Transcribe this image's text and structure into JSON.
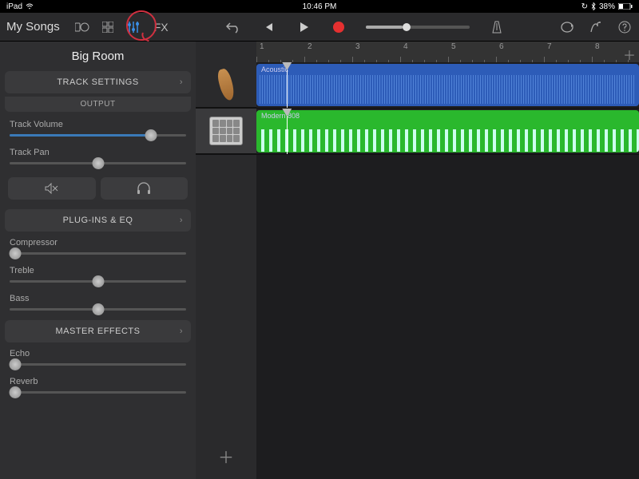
{
  "status": {
    "device": "iPad",
    "time": "10:46 PM",
    "battery": "38%"
  },
  "toolbar": {
    "my_songs": "My Songs",
    "fx": "FX"
  },
  "sidebar": {
    "room": "Big Room",
    "track_settings": "TRACK SETTINGS",
    "output": "OUTPUT",
    "track_volume": "Track Volume",
    "track_pan": "Track Pan",
    "plugins": "PLUG-INS & EQ",
    "compressor": "Compressor",
    "treble": "Treble",
    "bass": "Bass",
    "master_effects": "MASTER EFFECTS",
    "echo": "Echo",
    "reverb": "Reverb"
  },
  "sliders": {
    "volume": 80,
    "pan": 50,
    "compressor": 3,
    "treble": 50,
    "bass": 50,
    "echo": 3,
    "reverb": 3
  },
  "ruler": {
    "bars": [
      1,
      2,
      3,
      4,
      5,
      6,
      7,
      8
    ]
  },
  "tracks": [
    {
      "name": "Acoustic",
      "color": "blue"
    },
    {
      "name": "Modern 808",
      "color": "green"
    }
  ],
  "playhead_pct": 8
}
